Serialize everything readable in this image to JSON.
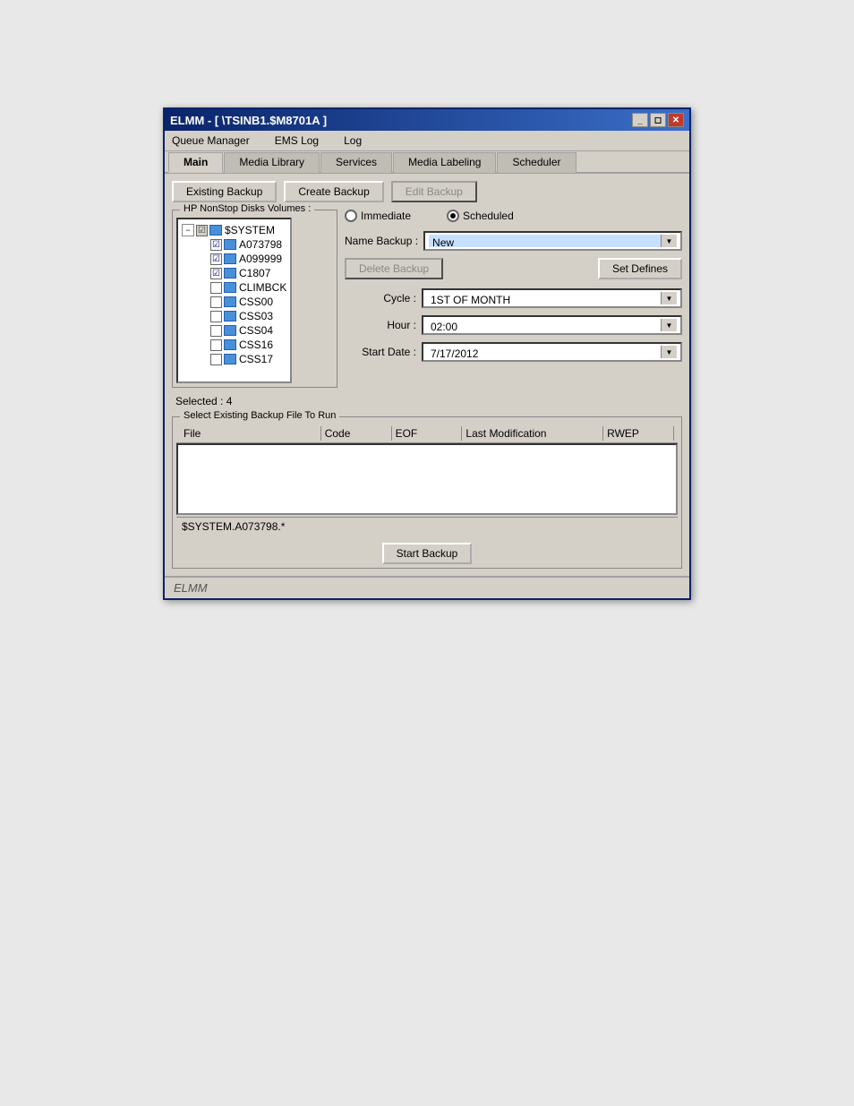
{
  "window": {
    "title": "ELMM - [ \\TSINB1.$M8701A ]",
    "status_label": "ELMM"
  },
  "title_buttons": {
    "minimize": "_",
    "restore": "◻",
    "close": "✕"
  },
  "menu": {
    "items": [
      "Queue Manager",
      "EMS Log",
      "Log"
    ]
  },
  "tabs": {
    "items": [
      "Main",
      "Media Library",
      "Services",
      "Media Labeling",
      "Scheduler"
    ],
    "active": "Main"
  },
  "toolbar": {
    "existing_backup": "Existing Backup",
    "create_backup": "Create Backup",
    "edit_backup": "Edit Backup"
  },
  "left_panel": {
    "group_title": "HP NonStop Disks Volumes :",
    "selected_label": "Selected : 4",
    "tree": {
      "root": "$SYSTEM",
      "items": [
        {
          "name": "A073798",
          "checked": true
        },
        {
          "name": "A099999",
          "checked": true
        },
        {
          "name": "C1807",
          "checked": true
        },
        {
          "name": "CLIMBCK",
          "checked": false
        },
        {
          "name": "CSS00",
          "checked": false
        },
        {
          "name": "CSS03",
          "checked": false
        },
        {
          "name": "CSS04",
          "checked": false
        },
        {
          "name": "CSS16",
          "checked": false
        },
        {
          "name": "CSS17",
          "checked": false
        }
      ]
    }
  },
  "right_panel": {
    "radio": {
      "immediate": "Immediate",
      "scheduled": "Scheduled",
      "selected": "scheduled"
    },
    "name_backup_label": "Name Backup :",
    "name_backup_value": "New",
    "delete_backup_label": "Delete Backup",
    "set_defines_label": "Set Defines",
    "cycle_label": "Cycle :",
    "cycle_value": "1ST OF MONTH",
    "hour_label": "Hour :",
    "hour_value": "02:00",
    "start_date_label": "Start Date :",
    "start_date_value": "7/17/2012"
  },
  "bottom_section": {
    "group_title": "Select Existing Backup File To Run",
    "columns": [
      "File",
      "Code",
      "EOF",
      "Last Modification",
      "RWEP"
    ],
    "path_display": "$SYSTEM.A073798.*",
    "start_backup": "Start Backup"
  }
}
